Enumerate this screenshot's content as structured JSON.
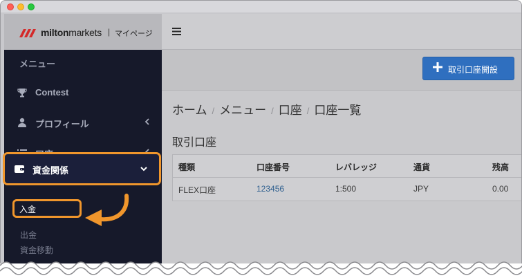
{
  "brand": {
    "name_bold": "milton",
    "name_rest": "markets",
    "separator": "|",
    "subtitle": "マイページ"
  },
  "sidebar": {
    "menu_header": "メニュー",
    "items": [
      {
        "label": "Contest",
        "icon": "trophy-icon"
      },
      {
        "label": "プロフィール",
        "icon": "user-icon"
      },
      {
        "label": "口座",
        "icon": "list-icon"
      },
      {
        "label": "資金関係",
        "icon": "wallet-icon",
        "active": true
      }
    ],
    "sub_items": [
      {
        "label": "入金",
        "active": true
      },
      {
        "label": "出金"
      },
      {
        "label": "資金移動"
      }
    ]
  },
  "toolbar": {
    "open_account_label": "取引口座開設"
  },
  "breadcrumb": [
    "ホーム",
    "メニュー",
    "口座",
    "口座一覧"
  ],
  "breadcrumb_separator": "/",
  "section_title": "取引口座",
  "table": {
    "columns": [
      "種類",
      "口座番号",
      "レバレッジ",
      "通貨",
      "残高"
    ],
    "rows": [
      [
        "FLEX口座",
        "123456",
        "1:500",
        "JPY",
        "0.00"
      ]
    ]
  },
  "colors": {
    "highlight": "#f0962c",
    "primary_button": "#2f6fbf",
    "sidebar_bg": "#16192a",
    "link": "#2e5f8f"
  }
}
